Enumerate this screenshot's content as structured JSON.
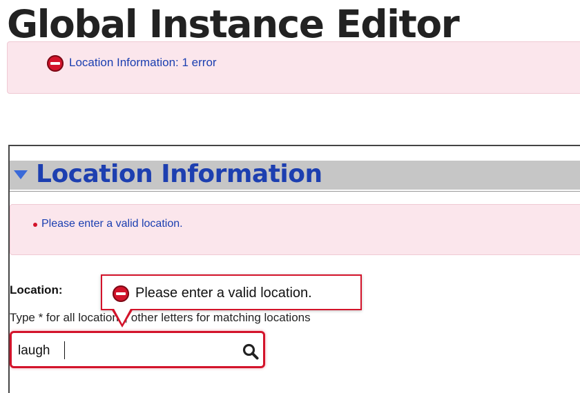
{
  "page": {
    "title": "Global Instance Editor"
  },
  "error_summary": {
    "icon": "error-stop-icon",
    "link_text": "Location Information: 1 error"
  },
  "section": {
    "title": "Location Information",
    "toggle_icon": "triangle-down-icon"
  },
  "field_errors": [
    "Please enter a valid location."
  ],
  "location_field": {
    "label": "Location:",
    "help_text": "Type * for all locations, other letters for matching locations",
    "value": "laugh",
    "search_icon": "search-icon"
  },
  "tooltip": {
    "icon": "error-stop-icon",
    "text": "Please enter a valid location."
  },
  "colors": {
    "error_red": "#d3132a",
    "error_background": "#fbe6ec",
    "link_blue": "#1a3eb0",
    "header_gray": "#c6c6c6"
  }
}
